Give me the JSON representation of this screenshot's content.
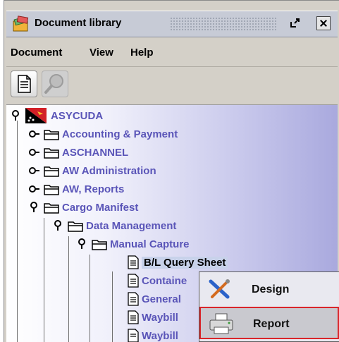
{
  "window": {
    "title": "Document library"
  },
  "menubar": {
    "items": [
      "Document",
      "View",
      "Help"
    ]
  },
  "toolbar": {
    "buttons": [
      {
        "name": "new-document",
        "icon": "document-icon",
        "enabled": true
      },
      {
        "name": "search",
        "icon": "magnifier-icon",
        "enabled": false
      }
    ]
  },
  "tree": {
    "root": "ASYCUDA",
    "nodes": [
      {
        "label": "Accounting & Payment"
      },
      {
        "label": "ASCHANNEL"
      },
      {
        "label": "AW Administration"
      },
      {
        "label": "AW, Reports"
      },
      {
        "label": "Cargo Manifest"
      },
      {
        "label": "Data Management"
      },
      {
        "label": "Manual Capture"
      },
      {
        "label": "B/L Query Sheet"
      },
      {
        "label": "Containe"
      },
      {
        "label": "General"
      },
      {
        "label": "Waybill"
      },
      {
        "label": "Waybill"
      }
    ]
  },
  "context_menu": {
    "items": [
      {
        "label": "Design",
        "icon": "design-tools-icon"
      },
      {
        "label": "Report",
        "icon": "printer-icon",
        "highlighted": true
      }
    ]
  },
  "colors": {
    "tree_text": "#5a55b8",
    "highlight_border": "#d9262b"
  }
}
